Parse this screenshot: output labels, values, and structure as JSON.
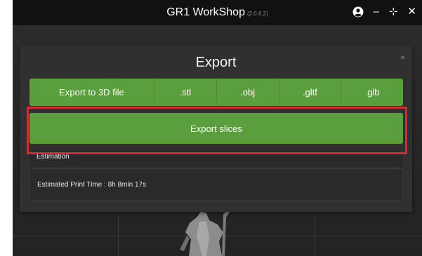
{
  "titlebar": {
    "app_title": "GR1 WorkShop",
    "version": "(2.0.6.2)",
    "user_icon": "user-circle-icon",
    "minimize_glyph": "–",
    "maximize_glyph": "⊹",
    "close_glyph": "✕"
  },
  "dialog": {
    "title": "Export",
    "close_glyph": "×",
    "export_to_3d_label": "Export to 3D file",
    "formats": [
      ".stl",
      ".obj",
      ".gltf",
      ".glb"
    ],
    "export_slices_label": "Export slices",
    "estimation_header": "Estimation",
    "estimated_print_time": "Estimated Print Time : 8h 8min 17s"
  },
  "colors": {
    "accent_green": "#5b9e3e",
    "highlight_red": "#d42b2b",
    "titlebar_bg": "#111111",
    "dialog_bg": "#303030"
  }
}
